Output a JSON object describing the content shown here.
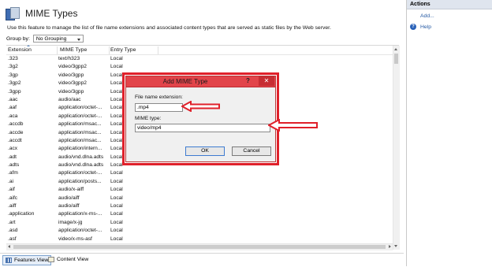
{
  "page": {
    "title": "MIME Types",
    "description": "Use this feature to manage the list of file name extensions and associated content types that are served as static files by the Web server.",
    "group_by_label": "Group by:",
    "group_by_value": "No Grouping"
  },
  "grid": {
    "columns": [
      "Extension",
      "MIME Type",
      "Entry Type"
    ],
    "rows": [
      [
        ".323",
        "text/h323",
        "Local"
      ],
      [
        ".3g2",
        "video/3gpp2",
        "Local"
      ],
      [
        ".3gp",
        "video/3gpp",
        "Local"
      ],
      [
        ".3gp2",
        "video/3gpp2",
        "Local"
      ],
      [
        ".3gpp",
        "video/3gpp",
        "Local"
      ],
      [
        ".aac",
        "audio/aac",
        "Local"
      ],
      [
        ".aaf",
        "application/octet-...",
        "Local"
      ],
      [
        ".aca",
        "application/octet-...",
        "Local"
      ],
      [
        ".accdb",
        "application/msac...",
        "Local"
      ],
      [
        ".accde",
        "application/msac...",
        "Local"
      ],
      [
        ".accdt",
        "application/msac...",
        "Local"
      ],
      [
        ".acx",
        "application/intern...",
        "Local"
      ],
      [
        ".adt",
        "audio/vnd.dlna.adts",
        "Local"
      ],
      [
        ".adts",
        "audio/vnd.dlna.adts",
        "Local"
      ],
      [
        ".afm",
        "application/octet-...",
        "Local"
      ],
      [
        ".ai",
        "application/posts...",
        "Local"
      ],
      [
        ".aif",
        "audio/x-aiff",
        "Local"
      ],
      [
        ".aifc",
        "audio/aiff",
        "Local"
      ],
      [
        ".aiff",
        "audio/aiff",
        "Local"
      ],
      [
        ".application",
        "application/x-ms-...",
        "Local"
      ],
      [
        ".art",
        "image/x-jg",
        "Local"
      ],
      [
        ".asd",
        "application/octet-...",
        "Local"
      ],
      [
        ".asf",
        "video/x-ms-asf",
        "Local"
      ],
      [
        ".asi",
        "application/octet-...",
        "Local"
      ]
    ]
  },
  "tabs": {
    "features_view": "Features View",
    "content_view": "Content View"
  },
  "actions": {
    "header": "Actions",
    "add": "Add...",
    "help": "Help"
  },
  "dialog": {
    "title": "Add MIME Type",
    "help_glyph": "?",
    "close_glyph": "✕",
    "ext_label": "File name extension:",
    "ext_value": ".mp4",
    "mime_label": "MIME type:",
    "mime_value": "video/mp4",
    "ok": "OK",
    "cancel": "Cancel"
  },
  "colors": {
    "annotation": "#e0202a",
    "link": "#2358a3"
  },
  "icons": {
    "page": "mime-types-icon",
    "help": "help-icon",
    "features_view": "features-view-icon",
    "content_view": "content-view-icon"
  }
}
